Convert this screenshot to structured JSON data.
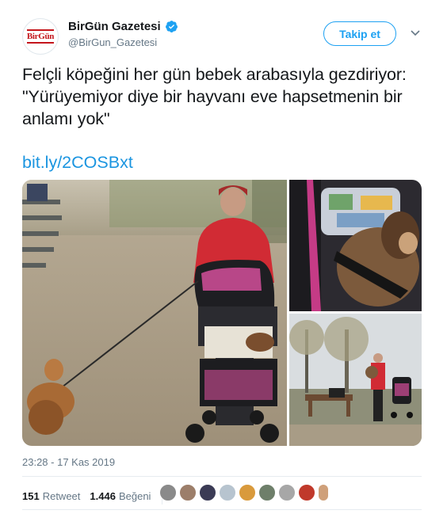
{
  "header": {
    "avatar_logo": "BirGün",
    "display_name": "BirGün Gazetesi",
    "handle": "@BirGun_Gazetesi",
    "follow_label": "Takip et",
    "verified_icon": "verified-badge-icon",
    "menu_icon": "chevron-down-icon"
  },
  "tweet": {
    "text": "Felçli köpeğini her gün bebek arabasıyla gezdiriyor: \"Yürüyemiyor diye bir hayvanı eve hapsetmenin bir anlamı yok\"",
    "link": "bit.ly/2COSBxt"
  },
  "media": {
    "count": 3
  },
  "meta": {
    "timestamp": "23:28 - 17 Kas 2019"
  },
  "stats": {
    "retweets": "151",
    "retweets_label": "Retweet",
    "likes": "1.446",
    "likes_label": "Beğeni",
    "liker_avatars": 9
  },
  "colors": {
    "accent": "#1da1f2",
    "link": "#1b95e0",
    "secondary_text": "#657786",
    "brand_red": "#c4161c"
  }
}
